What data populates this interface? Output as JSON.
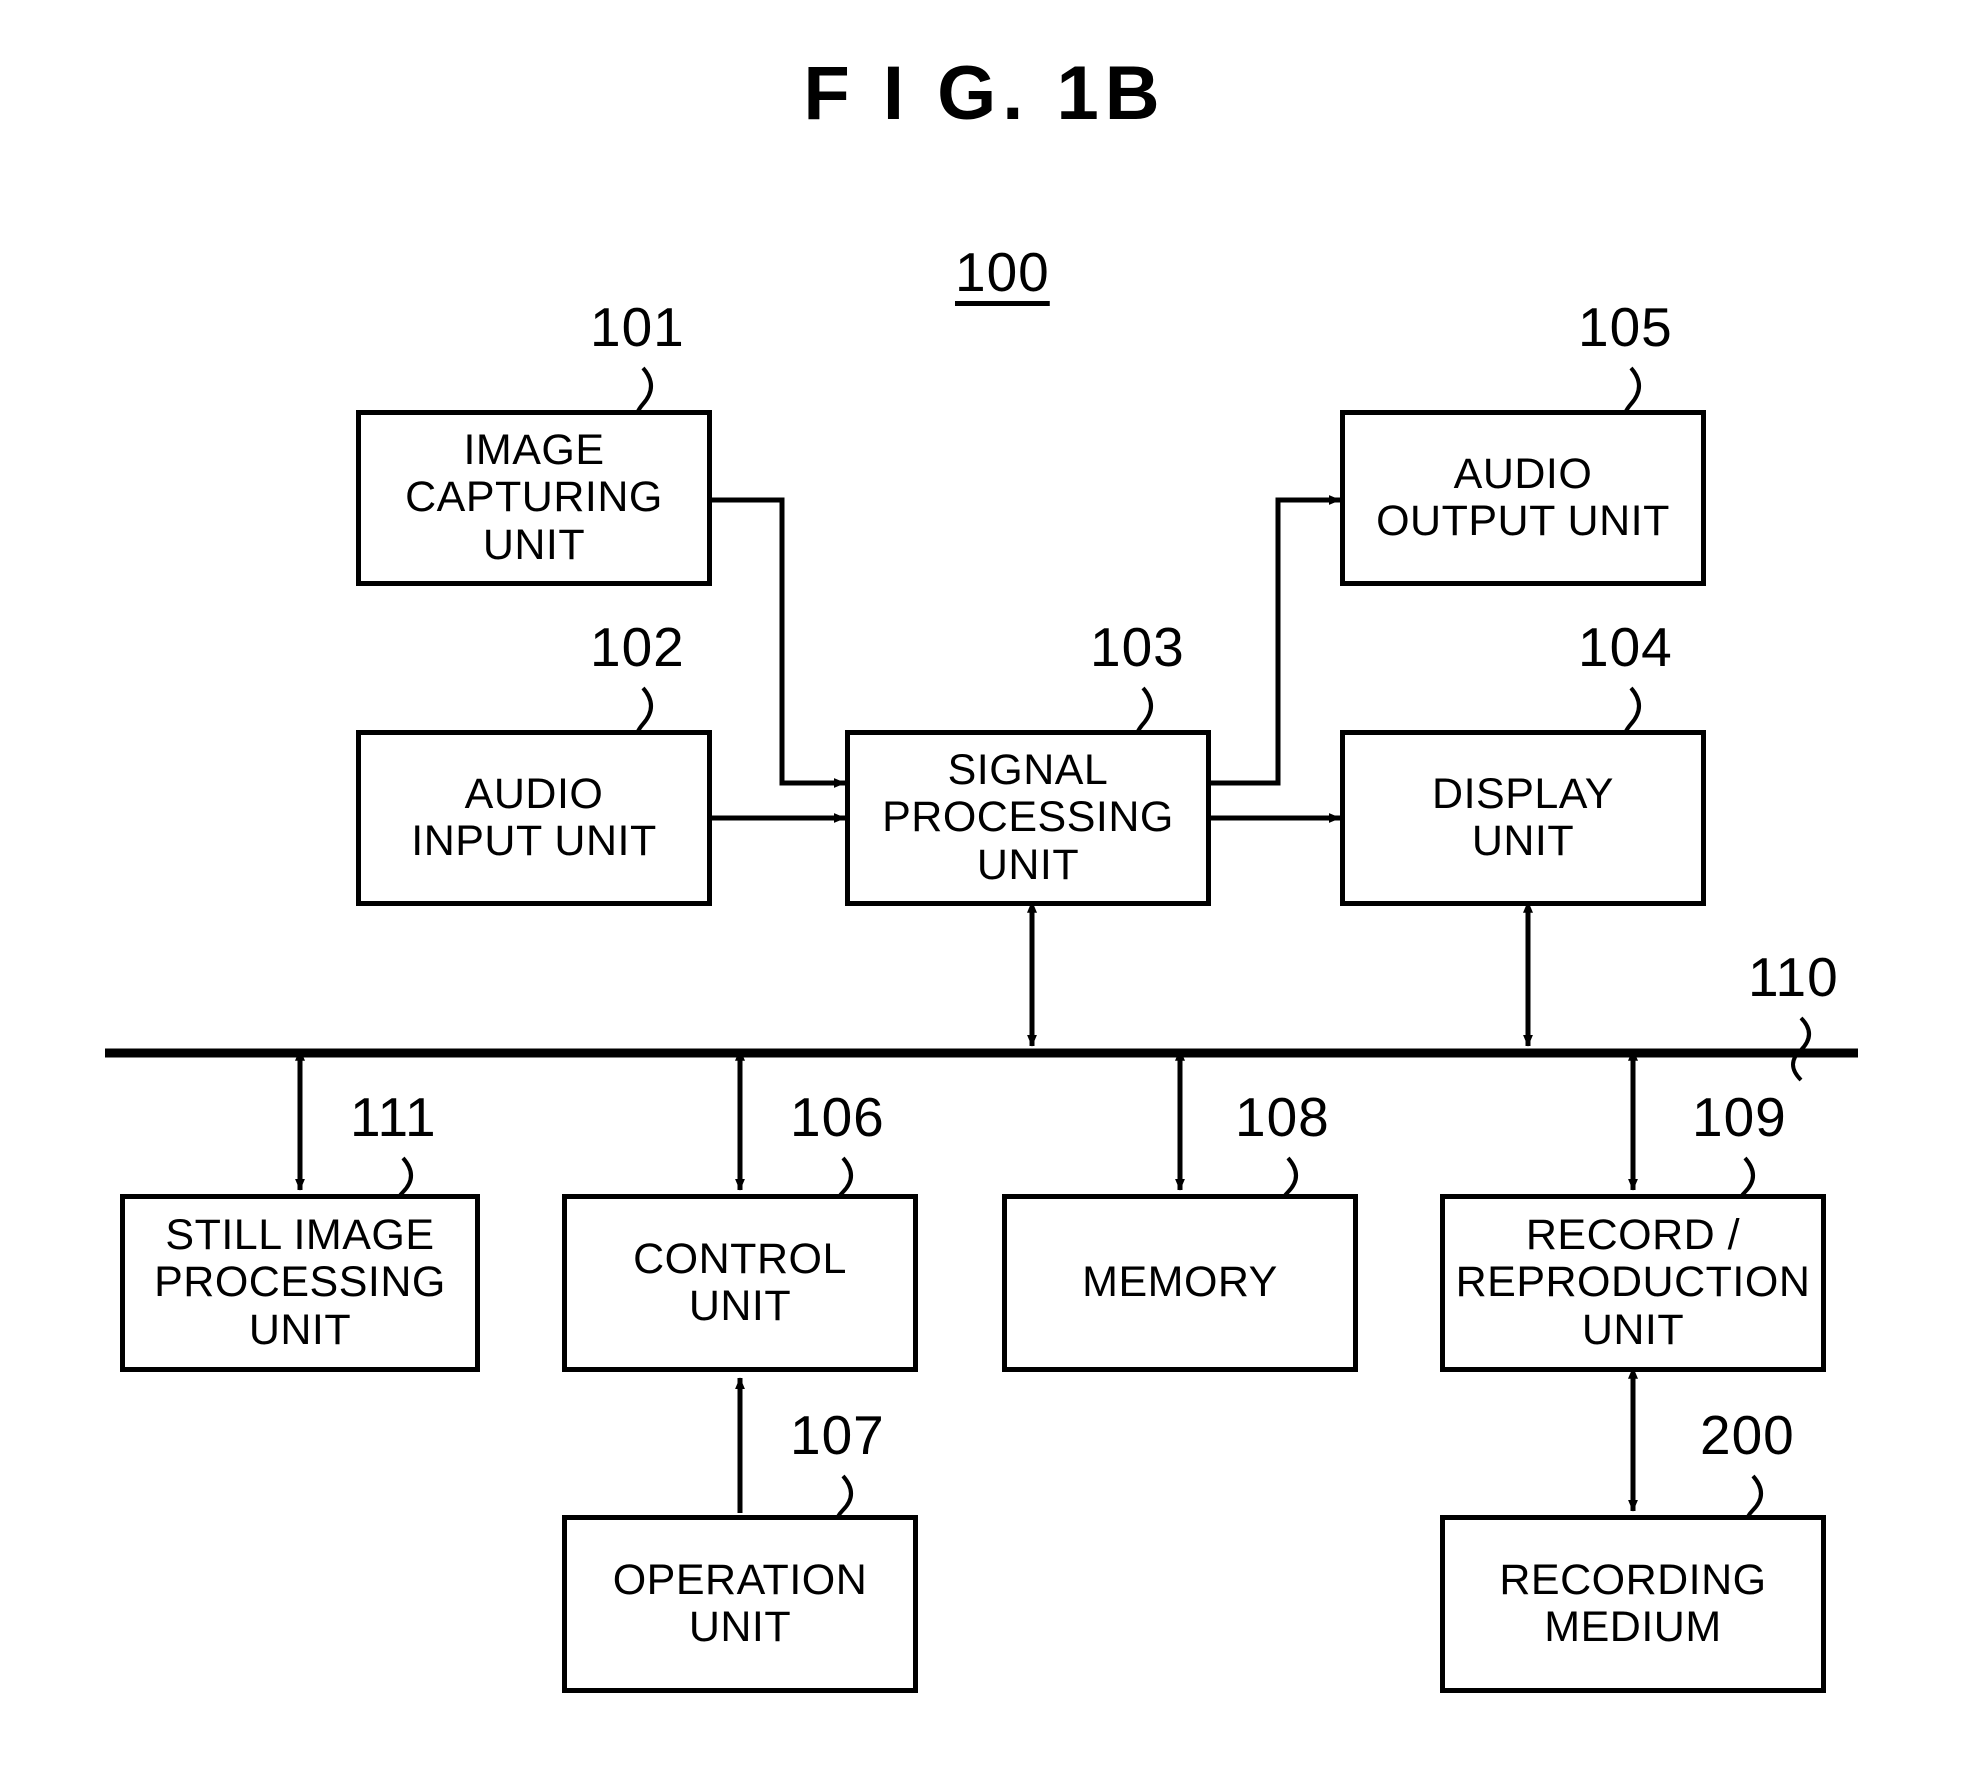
{
  "figure": {
    "title": "F I G.  1B",
    "system_label": "100"
  },
  "blocks": [
    {
      "id": "image-capturing-unit",
      "ref": "101",
      "label": "IMAGE\nCAPTURING\nUNIT"
    },
    {
      "id": "audio-input-unit",
      "ref": "102",
      "label": "AUDIO\nINPUT UNIT"
    },
    {
      "id": "signal-processing-unit",
      "ref": "103",
      "label": "SIGNAL\nPROCESSING\nUNIT"
    },
    {
      "id": "display-unit",
      "ref": "104",
      "label": "DISPLAY\nUNIT"
    },
    {
      "id": "audio-output-unit",
      "ref": "105",
      "label": "AUDIO\nOUTPUT UNIT"
    },
    {
      "id": "control-unit",
      "ref": "106",
      "label": "CONTROL\nUNIT"
    },
    {
      "id": "operation-unit",
      "ref": "107",
      "label": "OPERATION\nUNIT"
    },
    {
      "id": "memory",
      "ref": "108",
      "label": "MEMORY"
    },
    {
      "id": "record-reproduction-unit",
      "ref": "109",
      "label": "RECORD /\nREPRODUCTION\nUNIT"
    },
    {
      "id": "still-image-processing-unit",
      "ref": "111",
      "label": "STILL IMAGE\nPROCESSING\nUNIT"
    },
    {
      "id": "recording-medium",
      "ref": "200",
      "label": "RECORDING\nMEDIUM"
    }
  ],
  "bus": {
    "ref": "110"
  },
  "colors": {
    "ink": "#000000",
    "paper": "#ffffff"
  }
}
